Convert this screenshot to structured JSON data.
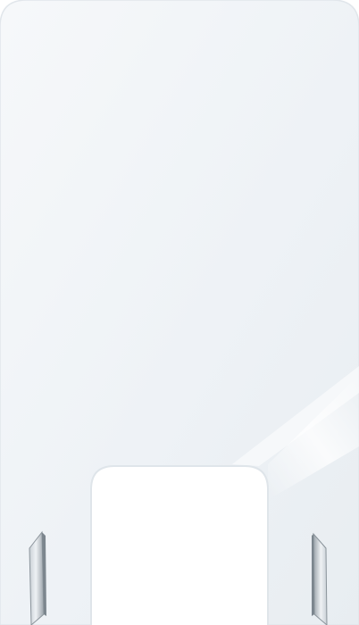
{
  "image": {
    "subject": "sneeze-guard-panel",
    "colors": {
      "background": "#ffffff",
      "panel_fill": "#f2f5f8",
      "panel_edge": "#dfe5ea",
      "panel_highlight": "#ffffff",
      "foot_light": "#d7dde2",
      "foot_dark": "#8b949b",
      "foot_edge": "#6f7880"
    }
  }
}
